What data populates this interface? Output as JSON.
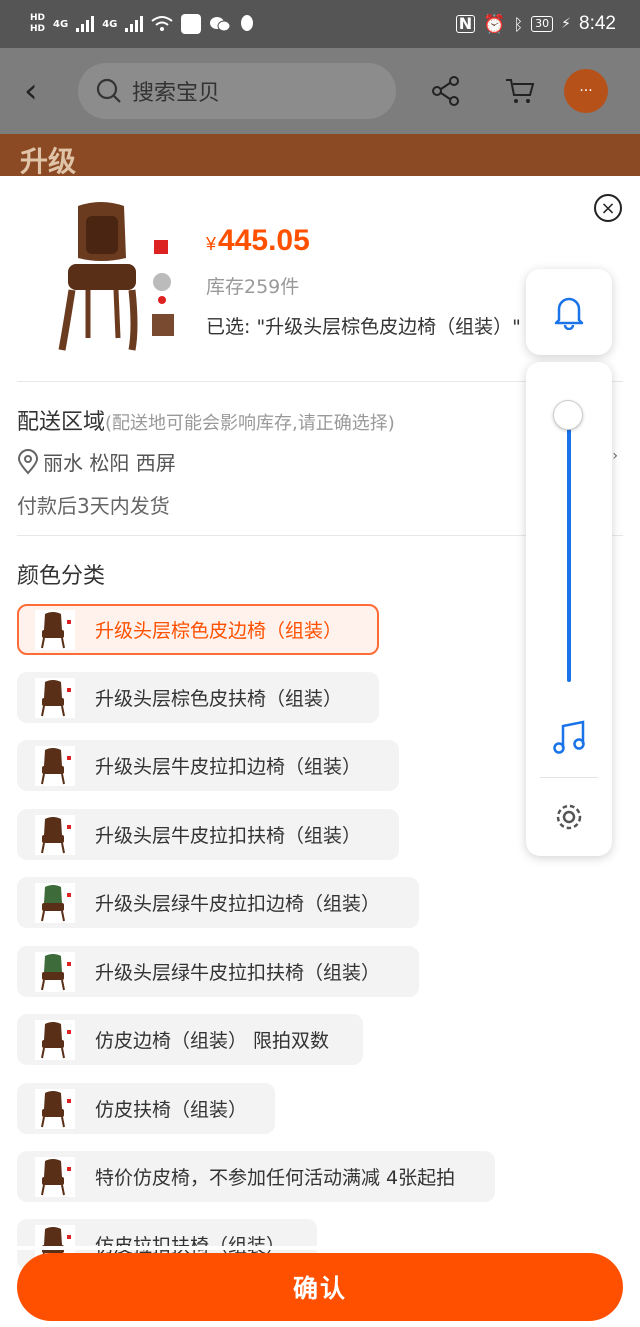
{
  "status_bar": {
    "hd_top": "HD",
    "hd_bottom": "HD",
    "net1": "4G",
    "net2": "4G",
    "battery": "30",
    "time": "8:42"
  },
  "header": {
    "search_placeholder": "搜索宝贝",
    "more_label": "···",
    "banner_text": "升级"
  },
  "product": {
    "currency": "¥",
    "price": "445.05",
    "stock": "库存259件",
    "selected": "已选: \"升级头层棕色皮边椅（组装）\""
  },
  "delivery": {
    "title": "配送区域",
    "hint": "(配送地可能会影响库存,请正确选择)",
    "location": "丽水 松阳 西屏",
    "ship_time": "付款后3天内发货"
  },
  "color": {
    "title": "颜色分类",
    "options": [
      {
        "label": "升级头层棕色皮边椅（组装）",
        "active": true
      },
      {
        "label": "升级头层棕色皮扶椅（组装）",
        "active": false
      },
      {
        "label": "升级头层牛皮拉扣边椅（组装）",
        "active": false
      },
      {
        "label": "升级头层牛皮拉扣扶椅（组装）",
        "active": false
      },
      {
        "label": "升级头层绿牛皮拉扣边椅（组装）",
        "active": false
      },
      {
        "label": "升级头层绿牛皮拉扣扶椅（组装）",
        "active": false
      },
      {
        "label": "仿皮边椅（组装）  限拍双数",
        "active": false
      },
      {
        "label": "仿皮扶椅（组装）",
        "active": false
      },
      {
        "label": "特价仿皮椅，不参加任何活动满减 4张起拍",
        "active": false
      },
      {
        "label": "仿皮拉扣扶椅（组装）",
        "active": false
      }
    ]
  },
  "confirm_label": "确认",
  "colors": {
    "accent": "#ff5000",
    "volume": "#1a73e8"
  },
  "volume_level": 1.0
}
